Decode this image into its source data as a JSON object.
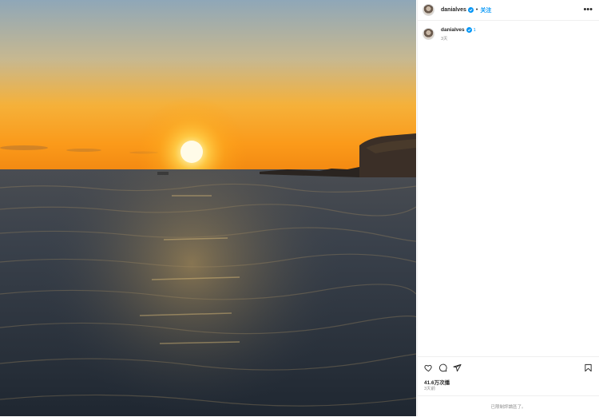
{
  "header": {
    "username": "danialves",
    "separator": "•",
    "follow_label": "关注",
    "more_label": "•••"
  },
  "caption": {
    "username": "danialves",
    "badge_count": "1",
    "time": "3天"
  },
  "stats": {
    "views": "41.6万次播",
    "time_ago": "3天前"
  },
  "footer": {
    "comments_disabled": "已限制評論區了。"
  },
  "colors": {
    "accent": "#0095f6",
    "verified": "#0095f6",
    "sun": "#ffe07a",
    "sky_top": "#8ea6b8",
    "sky_horizon": "#f7a51e",
    "sea": "#2b3440"
  },
  "icons": [
    "verified-badge-icon",
    "more-options-icon",
    "heart-icon",
    "comment-icon",
    "share-icon",
    "bookmark-icon"
  ]
}
